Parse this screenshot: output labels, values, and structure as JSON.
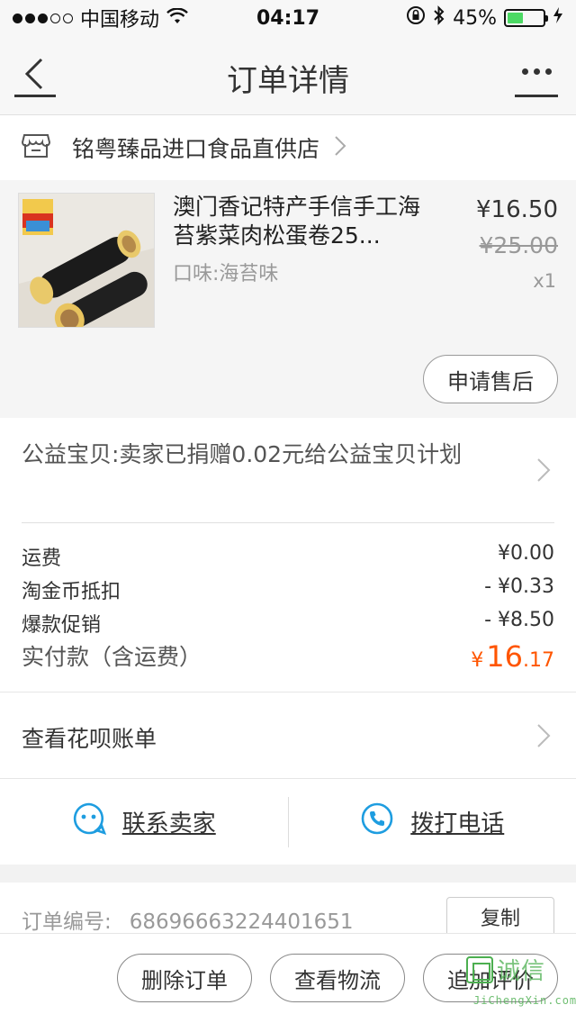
{
  "status_bar": {
    "carrier": "中国移动",
    "time": "04:17",
    "battery": "45%",
    "battery_level": 0.45
  },
  "nav": {
    "title": "订单详情"
  },
  "shop": {
    "name": "铭粤臻品进口食品直供店"
  },
  "product": {
    "title": "澳门香记特产手信手工海苔紫菜肉松蛋卷25...",
    "spec": "口味:海苔味",
    "price": "¥16.50",
    "original_price": "¥25.00",
    "quantity": "x1",
    "after_sale_button": "申请售后"
  },
  "charity": {
    "text": "公益宝贝:卖家已捐赠0.02元给公益宝贝计划"
  },
  "fees": {
    "rows": [
      {
        "label": "运费",
        "value": "¥0.00"
      },
      {
        "label": "淘金币抵扣",
        "value": "- ¥0.33"
      },
      {
        "label": "爆款促销",
        "value": "- ¥8.50"
      }
    ],
    "total_label": "实付款（含运费）",
    "total_currency": "¥",
    "total_int": "16",
    "total_dec": ".17"
  },
  "huabei": {
    "label": "查看花呗账单"
  },
  "contact": {
    "seller_label": "联系卖家",
    "phone_label": "拨打电话",
    "accent": "#1e9de0"
  },
  "order": {
    "number_label": "订单编号:",
    "number": "68696663224401651",
    "copy_button": "复制"
  },
  "bottom_actions": {
    "delete": "删除订单",
    "logistics": "查看物流",
    "review": "追加评价"
  },
  "watermark": {
    "cn": "诚信",
    "en": "JiChengXin.com"
  }
}
